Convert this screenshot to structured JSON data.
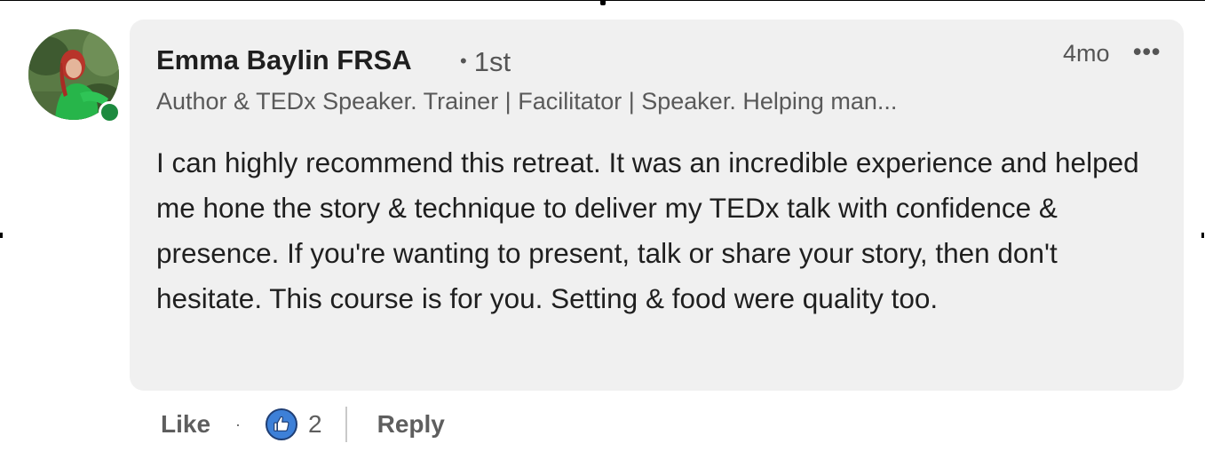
{
  "comment": {
    "author": {
      "name": "Emma Baylin FRSA",
      "connection": "1st",
      "headline": "Author & TEDx Speaker. Trainer | Facilitator | Speaker. Helping man...",
      "online": true
    },
    "timestamp": "4mo",
    "more_icon": "more-horizontal-icon",
    "text": "I can highly recommend this retreat. It was an incredible experience and helped me hone the story & technique to deliver my TEDx talk with confidence & presence. If you're wanting to present, talk or share your story, then don't hesitate. This course is for you. Setting & food were quality too."
  },
  "actions": {
    "like_label": "Like",
    "reaction_icon": "thumbs-up-icon",
    "reaction_count": "2",
    "reply_label": "Reply"
  },
  "colors": {
    "bubble_background": "#f0f0f0",
    "presence_green": "#1d8a3f",
    "like_blue": "#3d80d8"
  }
}
